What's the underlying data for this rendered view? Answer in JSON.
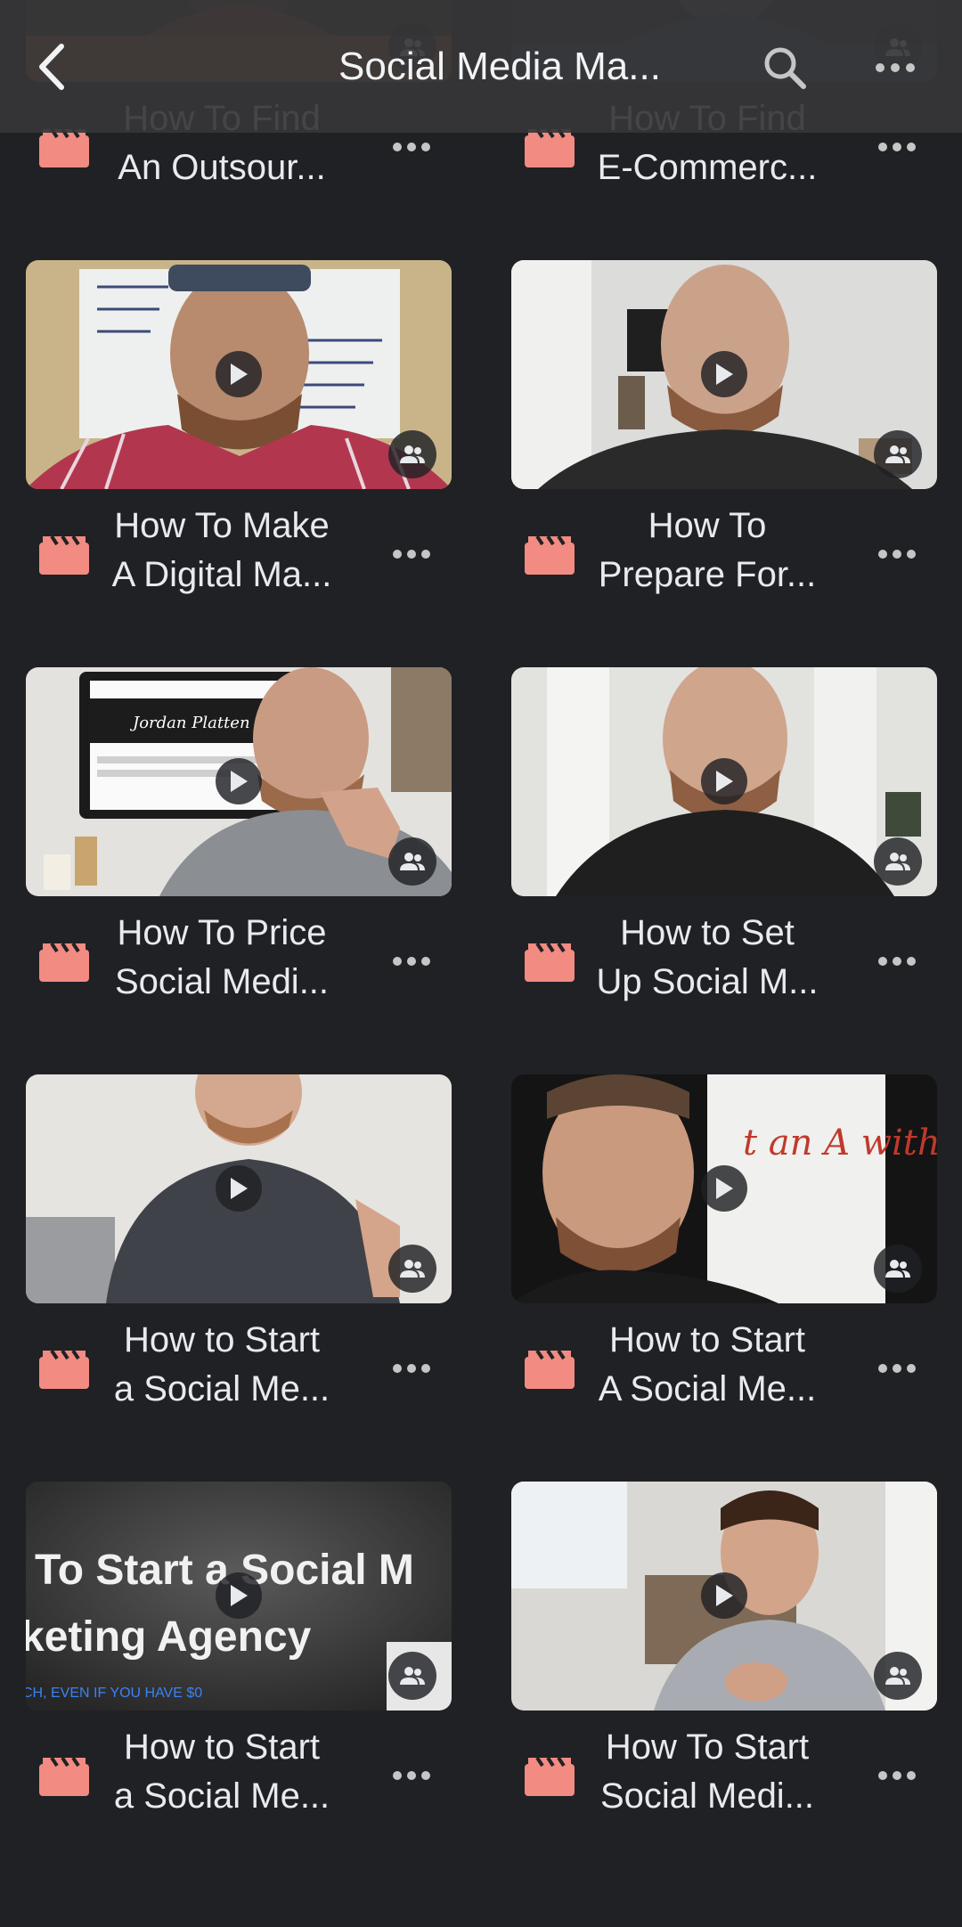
{
  "header": {
    "title": "Social Media Ma...",
    "back_icon": "chevron-left-icon",
    "search_icon": "search-icon",
    "more_icon": "more-horizontal-icon"
  },
  "colors": {
    "background": "#202124",
    "topbar": "#363638",
    "video_icon": "#f28b82",
    "text": "#e8eaed"
  },
  "videos": [
    {
      "title_line1": "How To Find",
      "title_line2": "An Outsour..."
    },
    {
      "title_line1": "How To Find",
      "title_line2": "E-Commerc..."
    },
    {
      "title_line1": "How To Make",
      "title_line2": "A Digital Ma..."
    },
    {
      "title_line1": "How To",
      "title_line2": "Prepare For..."
    },
    {
      "title_line1": "How To Price",
      "title_line2": "Social Medi..."
    },
    {
      "title_line1": "How to Set",
      "title_line2": "Up Social M..."
    },
    {
      "title_line1": "How to Start",
      "title_line2": "a Social Me..."
    },
    {
      "title_line1": "How to Start",
      "title_line2": "A Social Me..."
    },
    {
      "title_line1": "How to Start",
      "title_line2": "a Social Me..."
    },
    {
      "title_line1": "How To Start",
      "title_line2": "Social Medi..."
    }
  ],
  "thumbnail_text": {
    "whiteboard_scribble": "t an A with",
    "promo_line1": "To Start a Social M",
    "promo_line2": "keting Agency",
    "promo_line3": "CH, EVEN IF YOU HAVE $0",
    "monitor_signature": "Jordan Platten"
  },
  "icons": {
    "play": "play-icon",
    "shared": "shared-people-icon",
    "video_file": "video-file-icon",
    "more": "more-horizontal-icon"
  }
}
